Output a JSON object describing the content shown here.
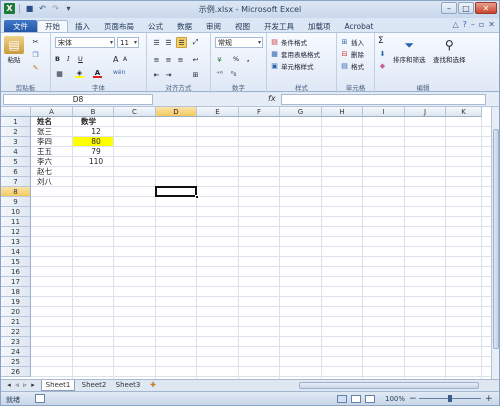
{
  "window": {
    "title": "示例.xlsx - Microsoft Excel"
  },
  "tabs": [
    "文件",
    "开始",
    "插入",
    "页面布局",
    "公式",
    "数据",
    "审阅",
    "视图",
    "开发工具",
    "加载项",
    "Acrobat"
  ],
  "ribbon": {
    "clipboard": {
      "paste": "粘贴",
      "label": "剪贴板"
    },
    "font": {
      "name": "宋体",
      "size": "11",
      "bold": "B",
      "italic": "I",
      "underline": "U",
      "grow": "A",
      "shrink": "A",
      "wen": "wén",
      "label": "字体"
    },
    "alignment": {
      "label": "对齐方式"
    },
    "number": {
      "format": "常规",
      "percent": "%",
      "comma": ",",
      "label": "数字"
    },
    "styles": {
      "conditional": "条件格式",
      "table": "套用表格格式",
      "cell": "单元格样式",
      "label": "样式"
    },
    "cells": {
      "insert": "插入",
      "delete": "删除",
      "format": "格式",
      "label": "单元格"
    },
    "editing": {
      "sigma": "Σ",
      "sort": "排序和筛选",
      "find": "查找和选择",
      "label": "编辑"
    }
  },
  "formula_bar": {
    "name_box": "D8",
    "fx": "fx",
    "value": ""
  },
  "columns": [
    "A",
    "B",
    "C",
    "D",
    "E",
    "F",
    "G",
    "H",
    "I",
    "J",
    "K"
  ],
  "selected_column": "D",
  "rows": [
    "1",
    "2",
    "3",
    "4",
    "5",
    "6",
    "7",
    "8",
    "9",
    "10",
    "11",
    "12",
    "13",
    "14",
    "15",
    "16",
    "17",
    "18",
    "19",
    "20",
    "21",
    "22",
    "23",
    "24",
    "25",
    "26"
  ],
  "selected_row": "8",
  "cells": {
    "A": [
      "姓名",
      "张三",
      "李四",
      "王五",
      "李六",
      "赵七",
      "刘八"
    ],
    "B": [
      "数学",
      "12",
      "80",
      "79",
      "110"
    ]
  },
  "highlight_color": "#ffff00",
  "sheets": [
    "Sheet1",
    "Sheet2",
    "Sheet3"
  ],
  "active_sheet": "Sheet1",
  "status": {
    "ready": "就绪",
    "zoom": "100%",
    "zoom_minus": "−",
    "zoom_plus": "+"
  },
  "colors": {
    "file_tab": "#2e63b4",
    "select_header": "#f5c85f",
    "ribbon_bg": "#dfe8f5"
  }
}
